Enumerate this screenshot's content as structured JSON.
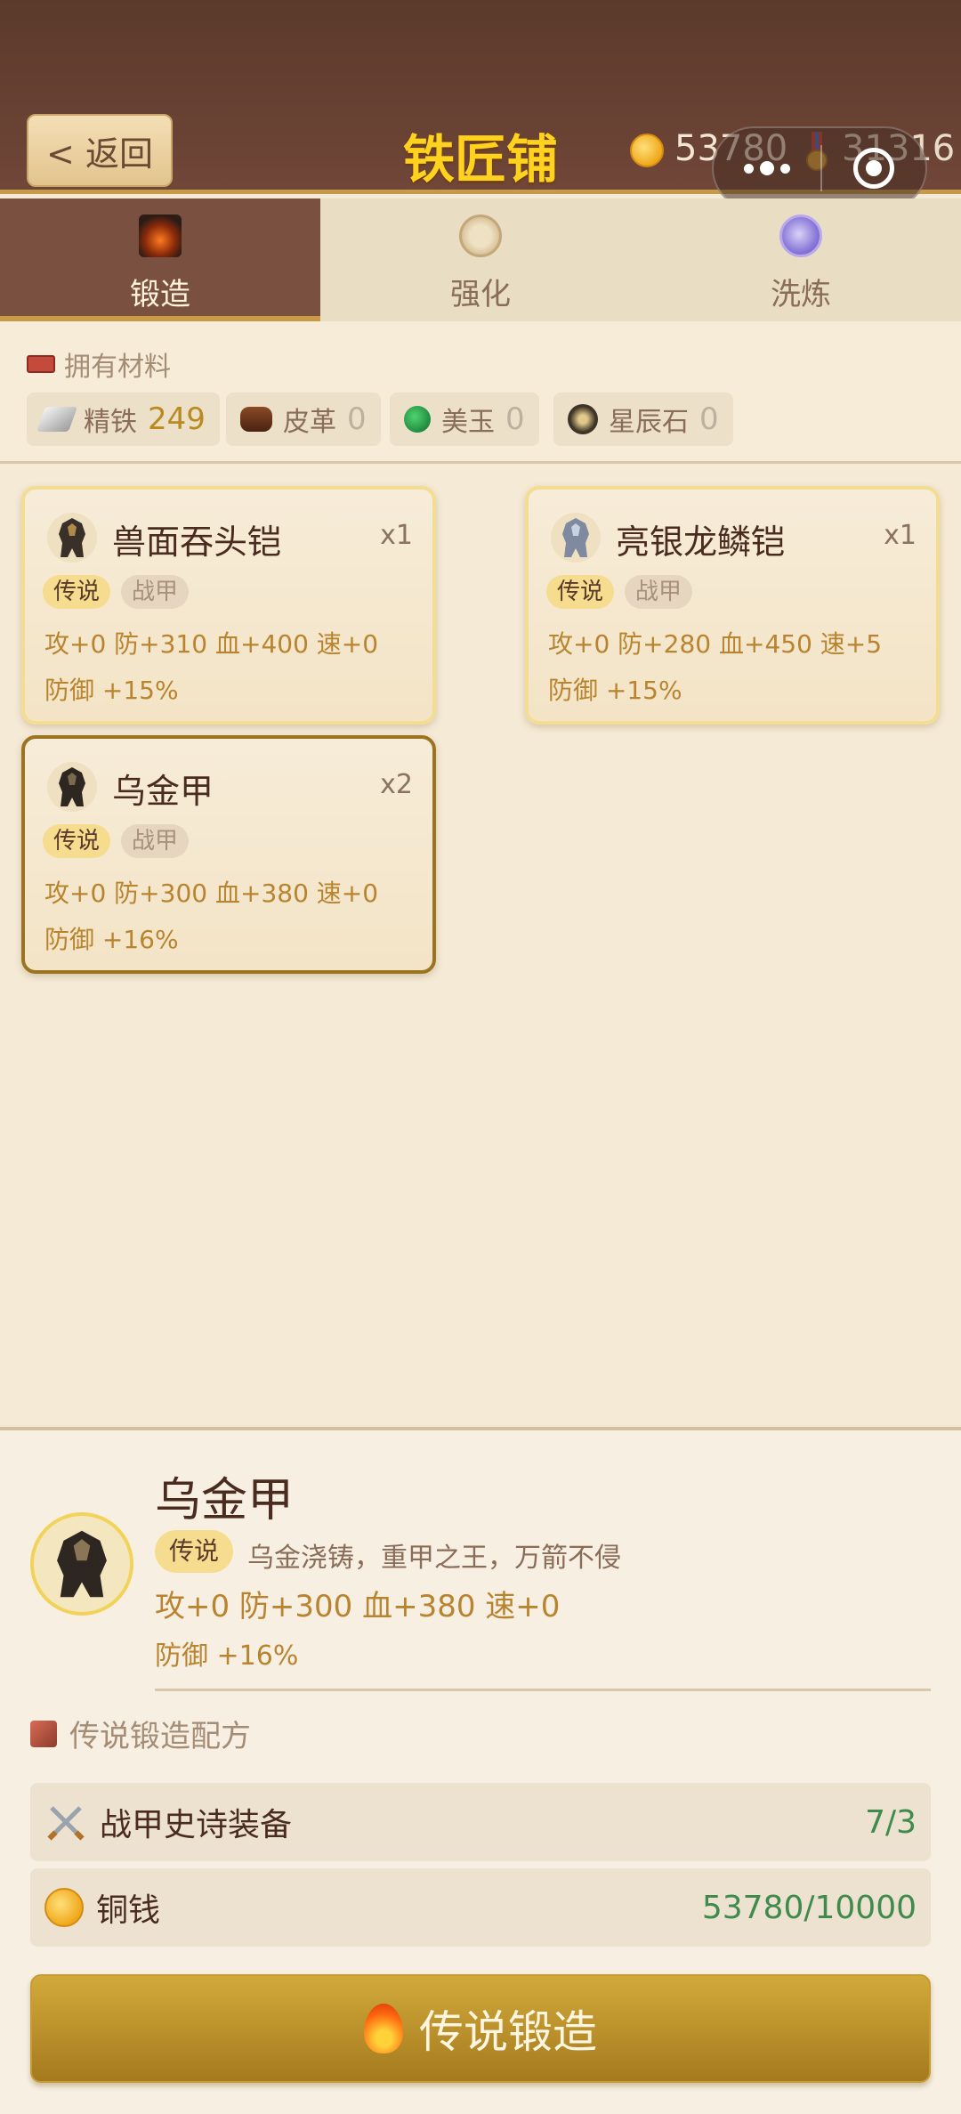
{
  "header": {
    "back_label": "< 返回",
    "title": "铁匠铺",
    "coins": "53780",
    "medals": "31316"
  },
  "tabs": [
    {
      "label": "锻造",
      "icon": "forge-icon",
      "active": true
    },
    {
      "label": "强化",
      "icon": "enhance-icon",
      "active": false
    },
    {
      "label": "洗炼",
      "icon": "refine-icon",
      "active": false
    }
  ],
  "materials": {
    "title": "拥有材料",
    "items": [
      {
        "name": "精铁",
        "count": "249",
        "icon": "iron-ingot-icon"
      },
      {
        "name": "皮革",
        "count": "0",
        "icon": "leather-icon"
      },
      {
        "name": "美玉",
        "count": "0",
        "icon": "jade-icon"
      },
      {
        "name": "星辰石",
        "count": "0",
        "icon": "star-stone-icon"
      }
    ]
  },
  "cards": [
    {
      "name": "兽面吞头铠",
      "count": "x1",
      "rarity": "传说",
      "type": "战甲",
      "stats": "攻+0 防+310 血+400 速+0",
      "bonus": "防御 +15%"
    },
    {
      "name": "亮银龙鳞铠",
      "count": "x1",
      "rarity": "传说",
      "type": "战甲",
      "stats": "攻+0 防+280 血+450 速+5",
      "bonus": "防御 +15%"
    },
    {
      "name": "乌金甲",
      "count": "x2",
      "rarity": "传说",
      "type": "战甲",
      "stats": "攻+0 防+300 血+380 速+0",
      "bonus": "防御 +16%",
      "selected": true
    }
  ],
  "detail": {
    "name": "乌金甲",
    "rarity": "传说",
    "description": "乌金浇铸，重甲之王，万箭不侵",
    "stats": "攻+0 防+300 血+380 速+0",
    "bonus": "防御 +16%",
    "recipe_title": "传说锻造配方",
    "requirements": [
      {
        "label": "战甲史诗装备",
        "value": "7/3",
        "icon": "crossed-swords-icon"
      },
      {
        "label": "铜钱",
        "value": "53780/10000",
        "icon": "coin-icon"
      }
    ],
    "forge_button": "传说锻造"
  }
}
